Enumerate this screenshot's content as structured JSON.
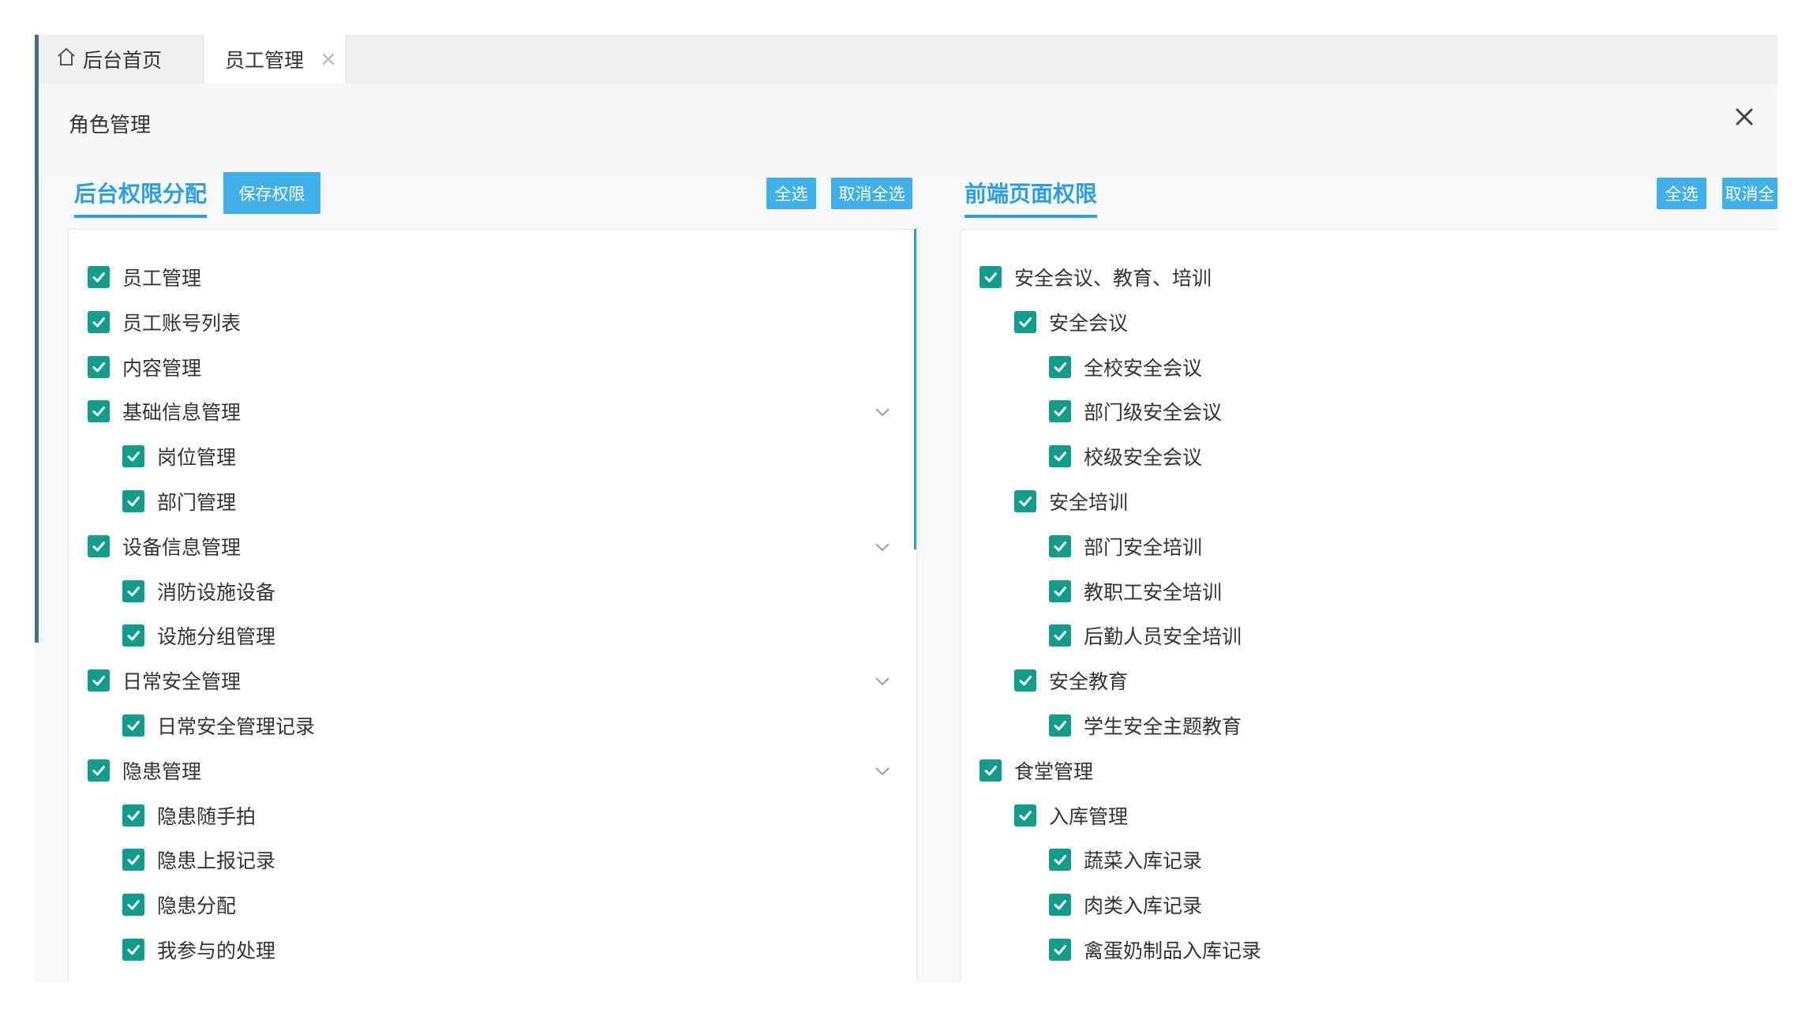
{
  "tabs": {
    "home_label": "后台首页",
    "active_label": "员工管理",
    "close_glyph": "×"
  },
  "dialog": {
    "title": "角色管理"
  },
  "left_panel": {
    "title": "后台权限分配",
    "save_label": "保存权限",
    "select_all_label": "全选",
    "deselect_all_label": "取消全选",
    "items": [
      {
        "label": "员工管理",
        "level": 0,
        "checked": true,
        "expandable": false
      },
      {
        "label": "员工账号列表",
        "level": 0,
        "checked": true,
        "expandable": false
      },
      {
        "label": "内容管理",
        "level": 0,
        "checked": true,
        "expandable": false
      },
      {
        "label": "基础信息管理",
        "level": 0,
        "checked": true,
        "expandable": true
      },
      {
        "label": "岗位管理",
        "level": 1,
        "checked": true,
        "expandable": false
      },
      {
        "label": "部门管理",
        "level": 1,
        "checked": true,
        "expandable": false
      },
      {
        "label": "设备信息管理",
        "level": 0,
        "checked": true,
        "expandable": true
      },
      {
        "label": "消防设施设备",
        "level": 1,
        "checked": true,
        "expandable": false
      },
      {
        "label": "设施分组管理",
        "level": 1,
        "checked": true,
        "expandable": false
      },
      {
        "label": "日常安全管理",
        "level": 0,
        "checked": true,
        "expandable": true
      },
      {
        "label": "日常安全管理记录",
        "level": 1,
        "checked": true,
        "expandable": false
      },
      {
        "label": "隐患管理",
        "level": 0,
        "checked": true,
        "expandable": true
      },
      {
        "label": "隐患随手拍",
        "level": 1,
        "checked": true,
        "expandable": false
      },
      {
        "label": "隐患上报记录",
        "level": 1,
        "checked": true,
        "expandable": false
      },
      {
        "label": "隐患分配",
        "level": 1,
        "checked": true,
        "expandable": false
      },
      {
        "label": "我参与的处理",
        "level": 1,
        "checked": true,
        "expandable": false
      }
    ]
  },
  "right_panel": {
    "title": "前端页面权限",
    "select_all_label": "全选",
    "deselect_all_label": "取消全",
    "items": [
      {
        "label": "安全会议、教育、培训",
        "level": 0,
        "checked": true,
        "expandable": true
      },
      {
        "label": "安全会议",
        "level": 1,
        "checked": true,
        "expandable": true
      },
      {
        "label": "全校安全会议",
        "level": 2,
        "checked": true,
        "expandable": false
      },
      {
        "label": "部门级安全会议",
        "level": 2,
        "checked": true,
        "expandable": false
      },
      {
        "label": "校级安全会议",
        "level": 2,
        "checked": true,
        "expandable": false
      },
      {
        "label": "安全培训",
        "level": 1,
        "checked": true,
        "expandable": true
      },
      {
        "label": "部门安全培训",
        "level": 2,
        "checked": true,
        "expandable": false
      },
      {
        "label": "教职工安全培训",
        "level": 2,
        "checked": true,
        "expandable": false
      },
      {
        "label": "后勤人员安全培训",
        "level": 2,
        "checked": true,
        "expandable": false
      },
      {
        "label": "安全教育",
        "level": 1,
        "checked": true,
        "expandable": true
      },
      {
        "label": "学生安全主题教育",
        "level": 2,
        "checked": true,
        "expandable": false
      },
      {
        "label": "食堂管理",
        "level": 0,
        "checked": true,
        "expandable": true
      },
      {
        "label": "入库管理",
        "level": 1,
        "checked": true,
        "expandable": true
      },
      {
        "label": "蔬菜入库记录",
        "level": 2,
        "checked": true,
        "expandable": false
      },
      {
        "label": "肉类入库记录",
        "level": 2,
        "checked": true,
        "expandable": false
      },
      {
        "label": "禽蛋奶制品入库记录",
        "level": 2,
        "checked": true,
        "expandable": false
      }
    ]
  }
}
